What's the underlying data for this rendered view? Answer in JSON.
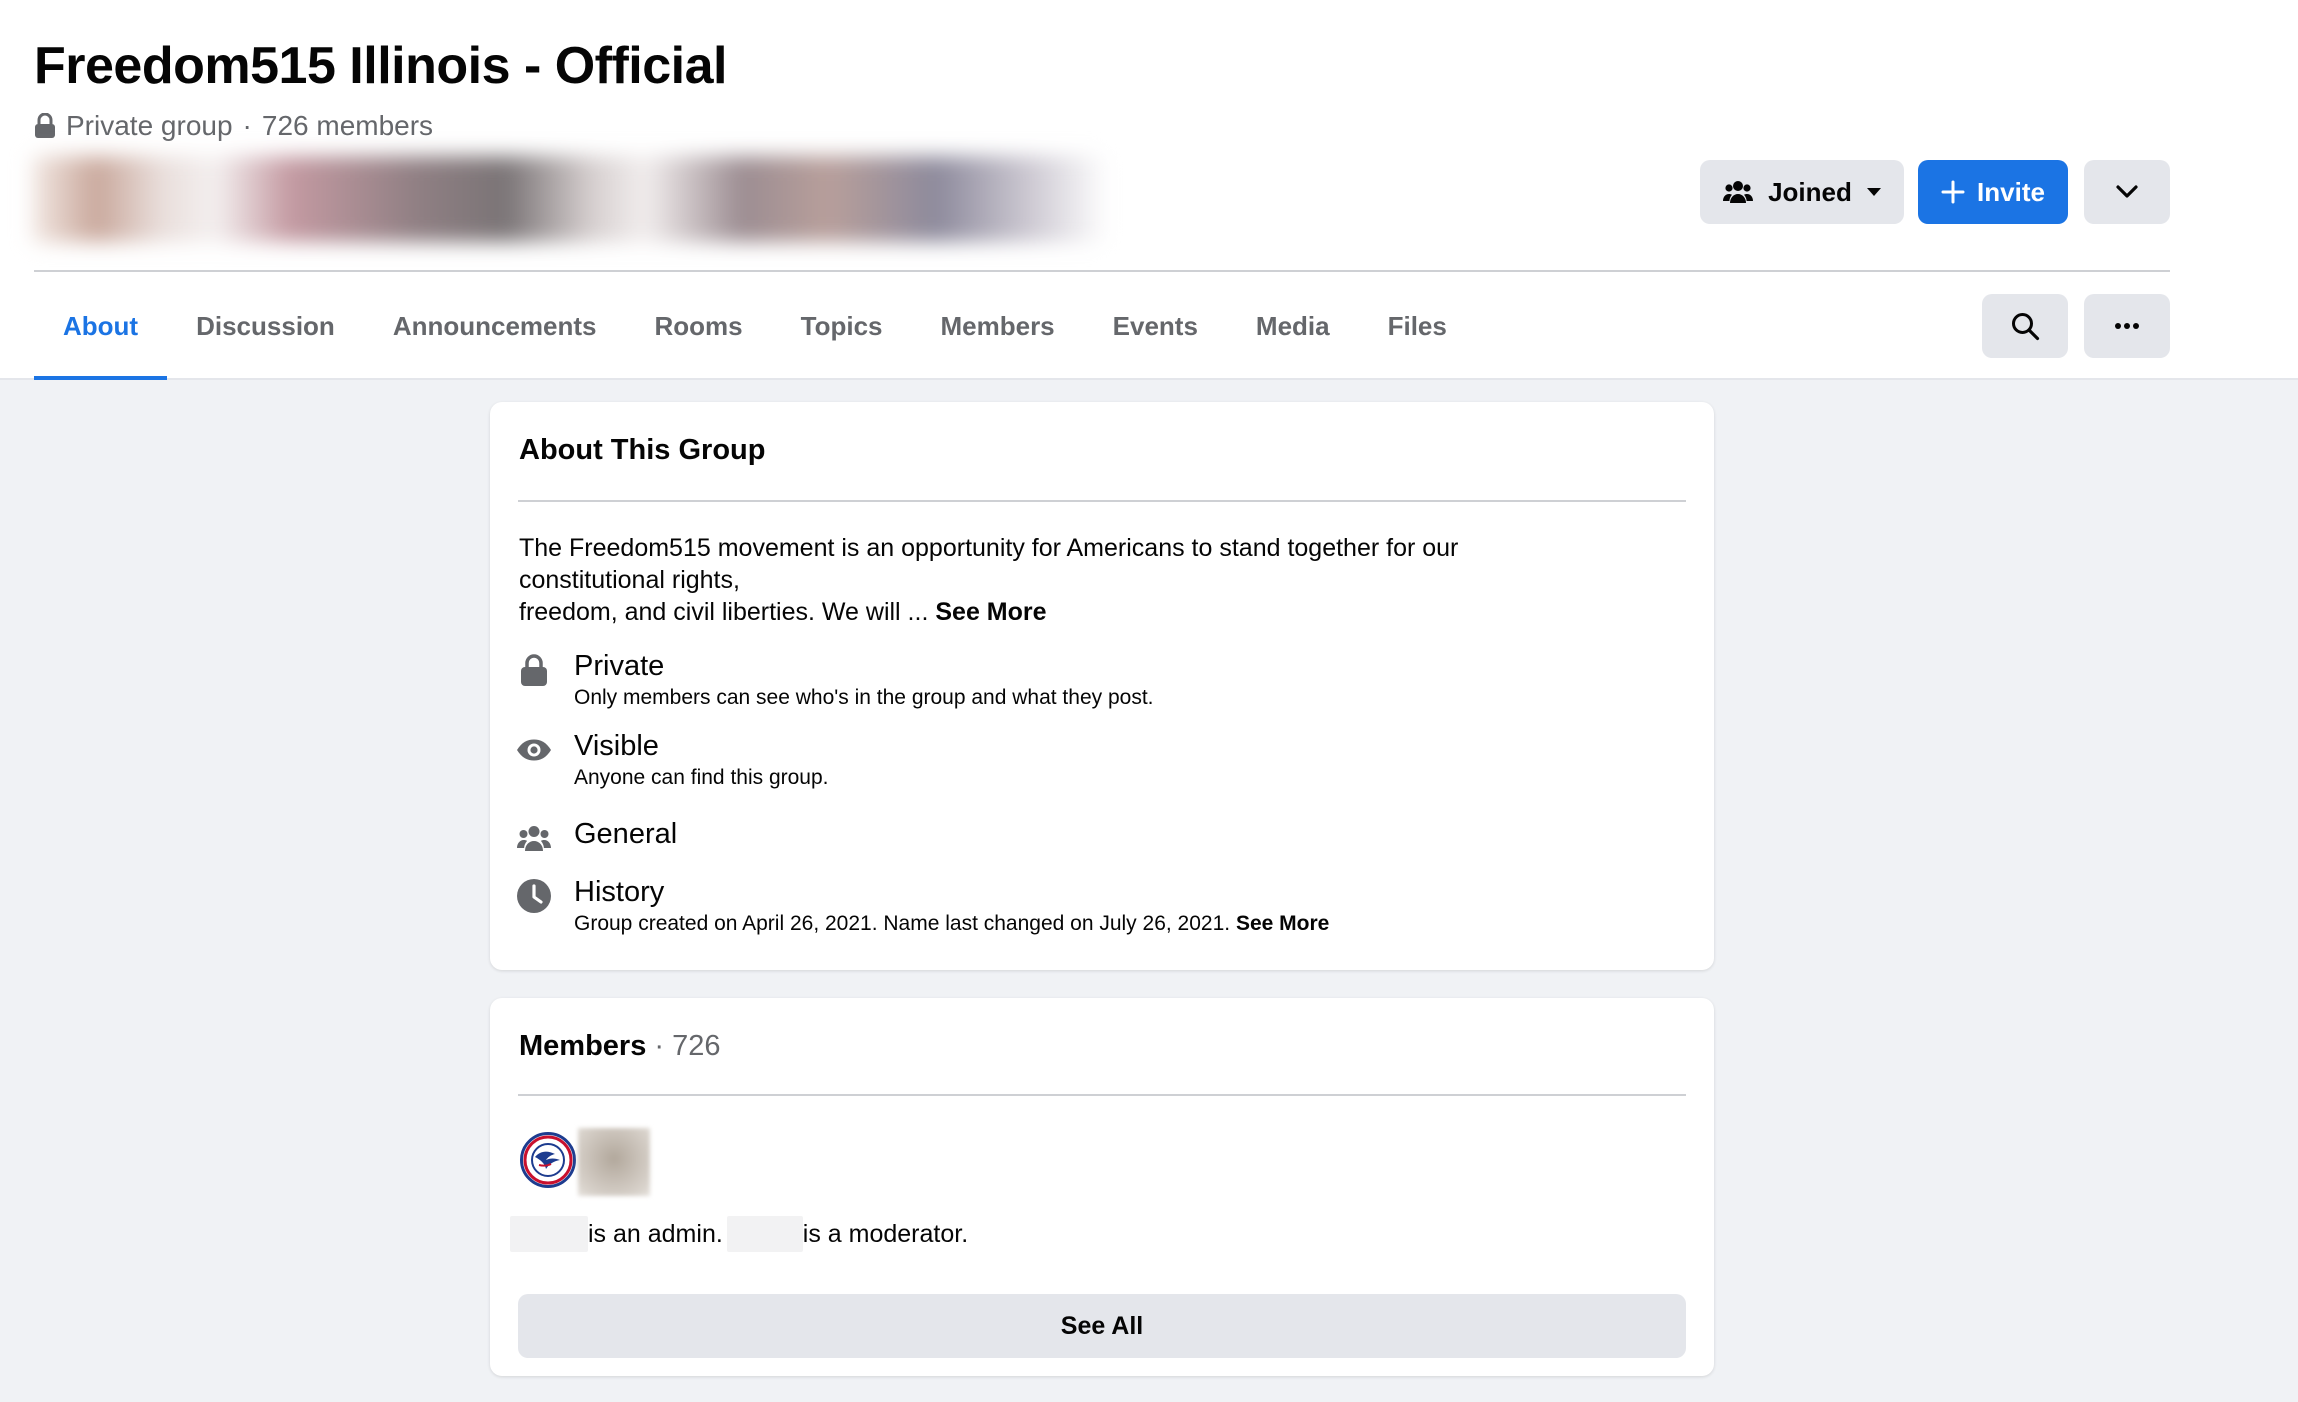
{
  "group": {
    "title": "Freedom515 Illinois - Official",
    "privacy_label": "Private group",
    "separator": "·",
    "members_label": "726 members"
  },
  "actions": {
    "joined_label": "Joined",
    "invite_label": "Invite"
  },
  "tabs": [
    {
      "label": "About",
      "active": true
    },
    {
      "label": "Discussion"
    },
    {
      "label": "Announcements"
    },
    {
      "label": "Rooms"
    },
    {
      "label": "Topics"
    },
    {
      "label": "Members"
    },
    {
      "label": "Events"
    },
    {
      "label": "Media"
    },
    {
      "label": "Files"
    }
  ],
  "about": {
    "title": "About This Group",
    "description_line1": "The Freedom515 movement is an opportunity for Americans to stand together for our",
    "description_line2": "constitutional rights,",
    "description_line3": "freedom, and civil liberties. We will ... ",
    "see_more": "See More",
    "items": [
      {
        "icon": "lock-icon",
        "title": "Private",
        "subtitle": "Only members can see who's in the group and what they post."
      },
      {
        "icon": "eye-icon",
        "title": "Visible",
        "subtitle": "Anyone can find this group."
      },
      {
        "icon": "group-icon",
        "title": "General"
      },
      {
        "icon": "clock-icon",
        "title": "History",
        "subtitle": "Group created on April 26, 2021. Name last changed on July 26, 2021. ",
        "see_more": "See More"
      }
    ]
  },
  "members": {
    "title": "Members",
    "separator": " · ",
    "count": "726",
    "admin_text": " is an admin.",
    "moderator_text": " is a moderator.",
    "see_all_label": "See All"
  },
  "colors": {
    "accent": "#1b74e4",
    "secondary_text": "#65676b",
    "button_gray": "#e4e6eb",
    "background": "#f0f2f5"
  }
}
